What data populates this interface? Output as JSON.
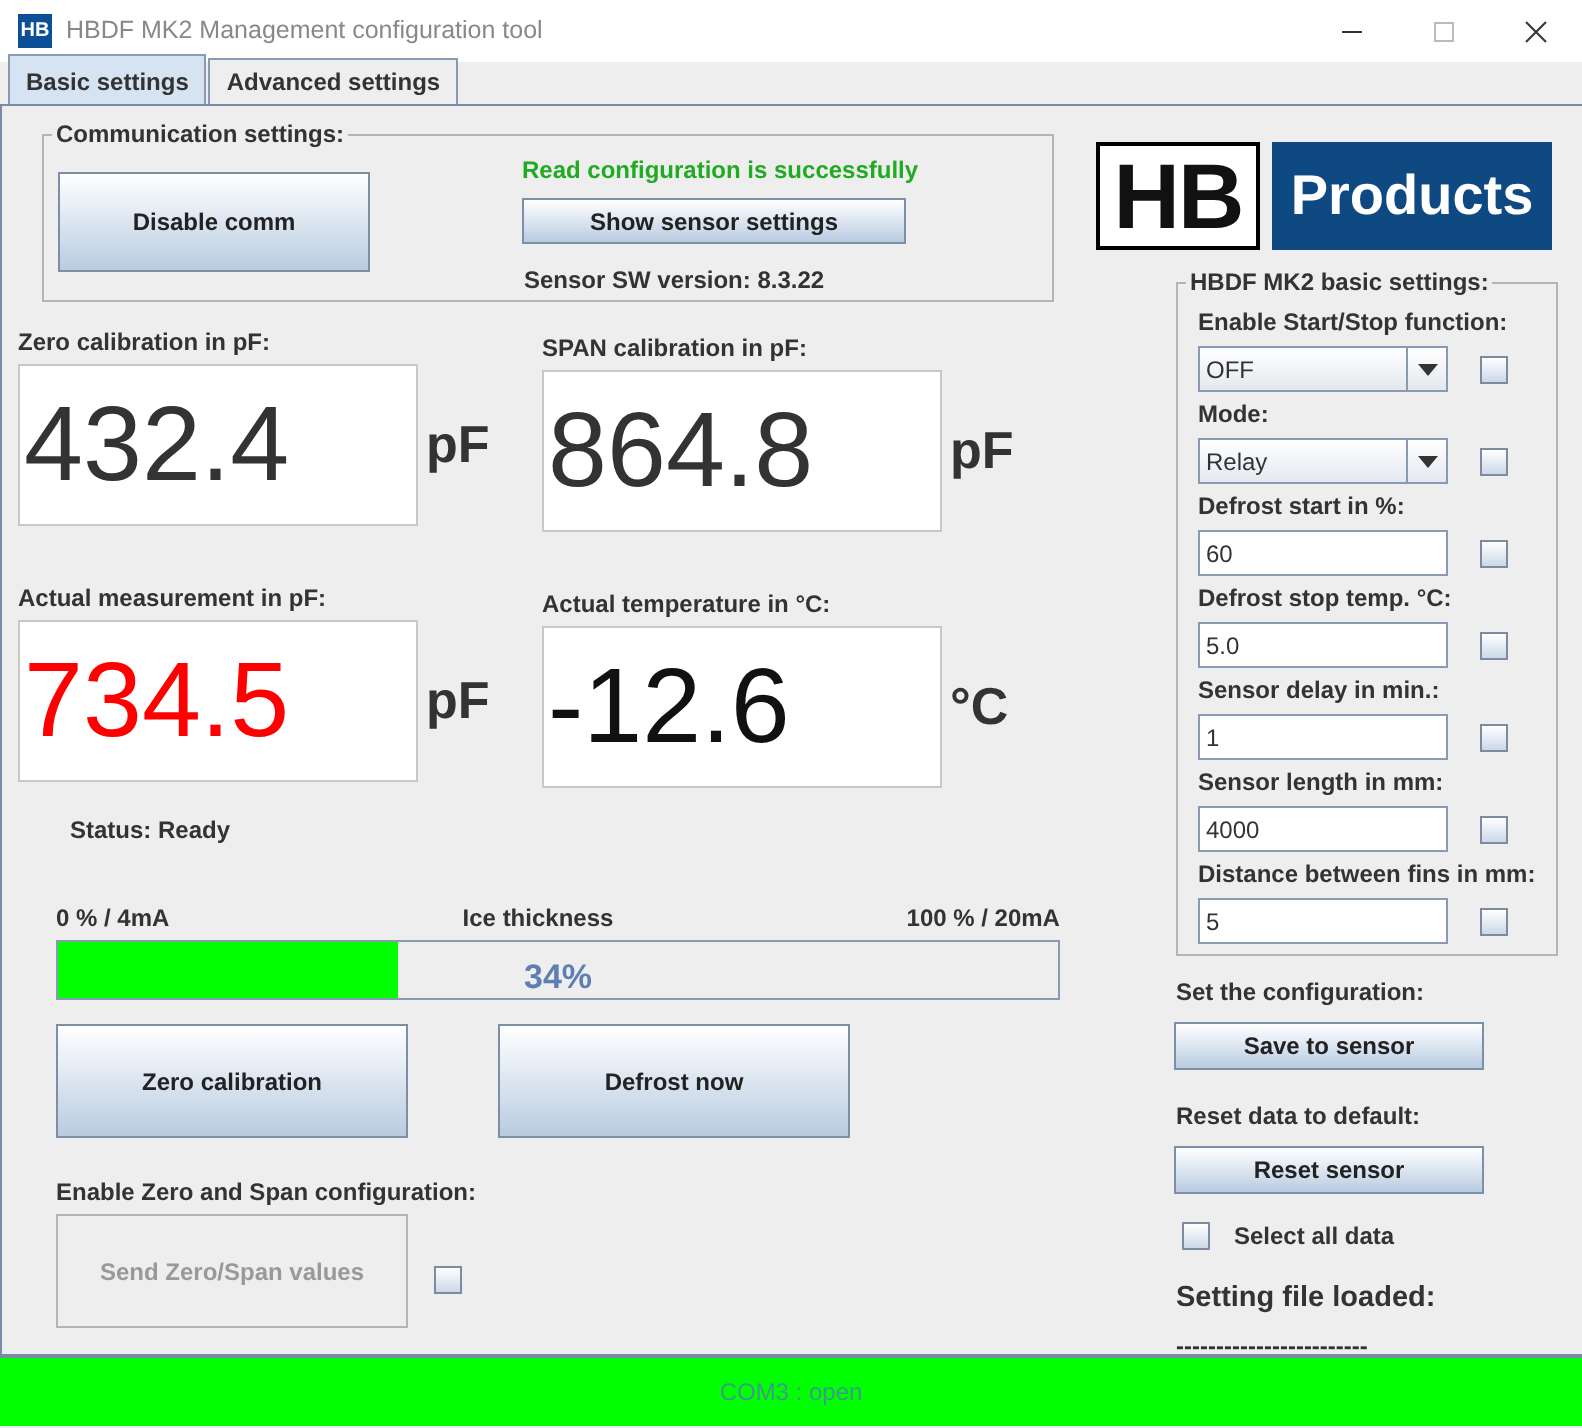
{
  "window": {
    "icon_text": "HB",
    "title": "HBDF MK2 Management configuration tool"
  },
  "tabs": [
    {
      "label": "Basic settings",
      "selected": true
    },
    {
      "label": "Advanced settings",
      "selected": false
    }
  ],
  "communication": {
    "legend": "Communication settings:",
    "button": "Disable comm",
    "message": "Read configuration is successfully",
    "show_button": "Show sensor settings",
    "sw_version": "Sensor SW version: 8.3.22"
  },
  "measurements": [
    {
      "label": "Zero calibration in pF:",
      "value": "432.4",
      "unit": "pF",
      "color": "#333333"
    },
    {
      "label": "SPAN calibration in pF:",
      "value": "864.8",
      "unit": "pF",
      "color": "#333333"
    },
    {
      "label": "Actual measurement in pF:",
      "value": "734.5",
      "unit": "pF",
      "color": "#ff0000"
    },
    {
      "label": "Actual temperature in °C:",
      "value": "-12.6",
      "unit": "°C",
      "color": "#111111"
    }
  ],
  "status": "Status: Ready",
  "ice": {
    "left_label": "0 % / 4mA",
    "title": "Ice thickness",
    "right_label": "100 % / 20mA",
    "level": 0.34,
    "reading": "34%"
  },
  "action_buttons": [
    "Zero calibration",
    "Defrost now"
  ],
  "zero_span": {
    "label": "Enable Zero and Span configuration:",
    "button": "Send Zero/Span values",
    "disabled": true,
    "checked": false
  },
  "logo": {
    "left": "HB",
    "right": "Products"
  },
  "basic_settings": {
    "legend": "HBDF MK2 basic settings:",
    "fields": [
      {
        "label": "Enable Start/Stop function:",
        "kind": "select",
        "value": "OFF",
        "checked": false
      },
      {
        "label": "Mode:",
        "kind": "select",
        "value": "Relay",
        "checked": false
      },
      {
        "label": "Defrost start in %:",
        "kind": "input",
        "value": "60",
        "checked": false
      },
      {
        "label": "Defrost stop temp. °C:",
        "kind": "input",
        "value": "5.0",
        "checked": false
      },
      {
        "label": "Sensor delay in min.:",
        "kind": "input",
        "value": "1",
        "checked": false
      },
      {
        "label": "Sensor length in mm:",
        "kind": "input",
        "value": "4000",
        "checked": false
      },
      {
        "label": "Distance between fins in mm:",
        "kind": "input",
        "value": "5",
        "checked": false
      }
    ]
  },
  "set_config": {
    "label": "Set the configuration:",
    "button": "Save to sensor"
  },
  "reset": {
    "label": "Reset data to default:",
    "button": "Reset sensor"
  },
  "select_all": {
    "label": "Select all data",
    "checked": false
  },
  "setting_file": {
    "label": "Setting file loaded:",
    "value": "------------------------"
  },
  "status_bar": "COM3 : open"
}
